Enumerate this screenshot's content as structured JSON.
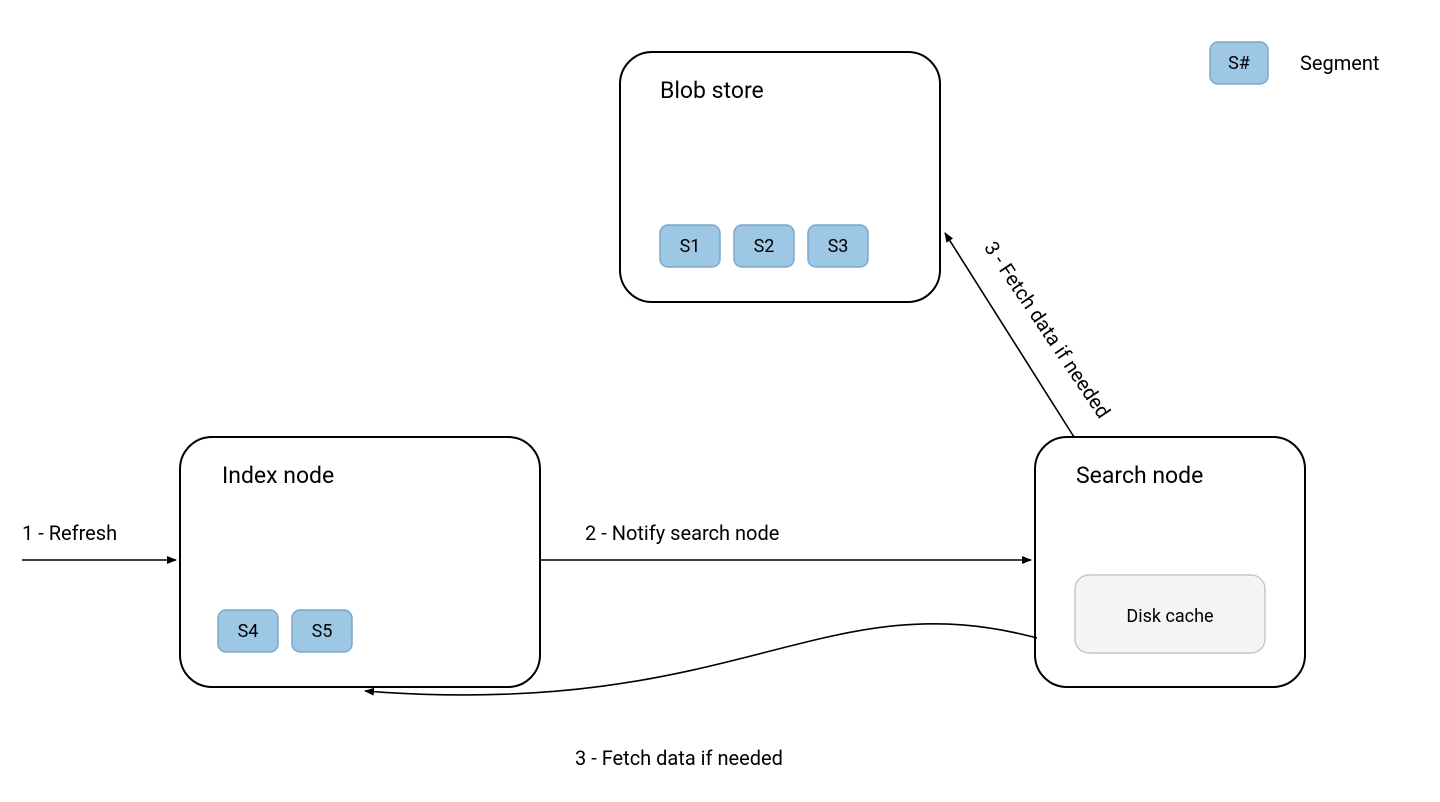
{
  "nodes": {
    "blob_store": {
      "title": "Blob store",
      "segments": [
        "S1",
        "S2",
        "S3"
      ]
    },
    "index_node": {
      "title": "Index node",
      "segments": [
        "S4",
        "S5"
      ]
    },
    "search_node": {
      "title": "Search node",
      "cache_label": "Disk cache"
    }
  },
  "arrows": {
    "refresh": "1 - Refresh",
    "notify": "2 - Notify search node",
    "fetch_top": "3 - Fetch data if needed",
    "fetch_bottom": "3 - Fetch data if needed"
  },
  "legend": {
    "swatch": "S#",
    "label": "Segment"
  },
  "colors": {
    "segment_fill": "#9ec7e6",
    "segment_stroke": "#7aa8cc",
    "box_stroke": "#000000",
    "cache_fill": "#f5f5f5",
    "cache_stroke": "#c8c8c8"
  }
}
